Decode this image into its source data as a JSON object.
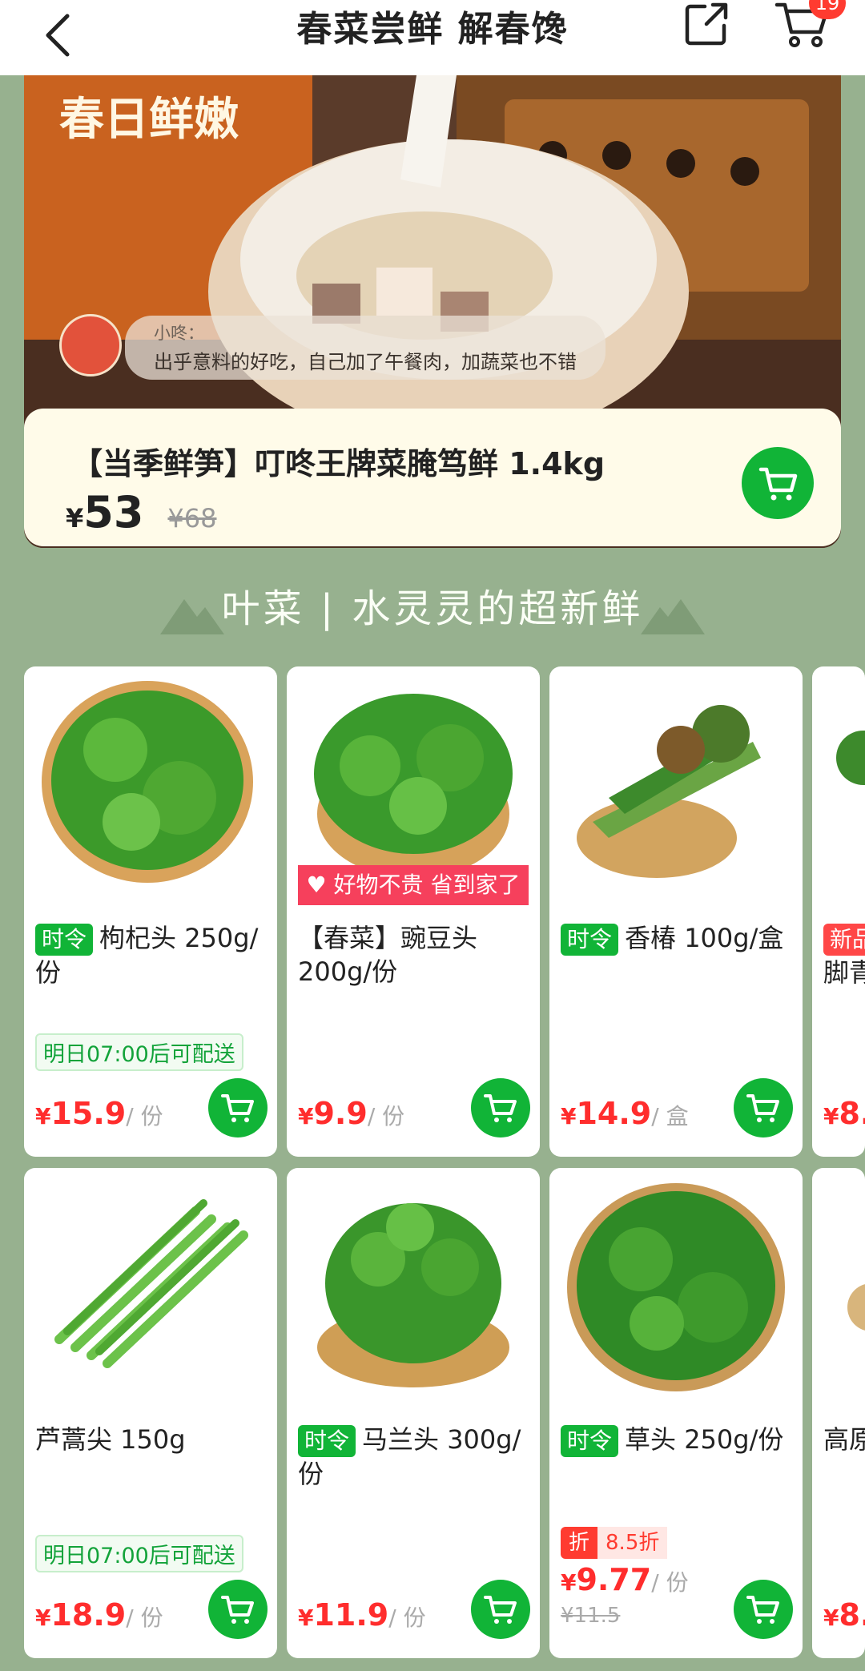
{
  "header": {
    "title": "春菜尝鲜 解春馋",
    "cart_badge": "19"
  },
  "hero": {
    "label": "春日鲜嫩",
    "comment_name": "小咚：",
    "comment_text": "出乎意料的好吃，自己加了午餐肉，加蔬菜也不错"
  },
  "promo": {
    "title": "【当季鲜笋】叮咚王牌菜腌笃鲜 1.4kg",
    "currency": "¥",
    "price": "53",
    "old_price": "¥68"
  },
  "section": {
    "title": "叶菜 | 水灵灵的超新鲜"
  },
  "products": [
    {
      "tag": "时令",
      "name": "枸杞头 250g/份",
      "delivery": "明日07:00后可配送",
      "currency": "¥",
      "price": "15.9",
      "unit": "/ 份"
    },
    {
      "ribbon": "好物不贵 省到家了",
      "name": "【春菜】豌豆头 200g/份",
      "currency": "¥",
      "price": "9.9",
      "unit": "/ 份"
    },
    {
      "tag": "时令",
      "name": "香椿 100g/盒",
      "currency": "¥",
      "price": "14.9",
      "unit": "/ 盒"
    },
    {
      "tag": "新品",
      "name": "脚青",
      "currency": "¥",
      "price": "8."
    },
    {
      "name": "芦蒿尖 150g",
      "delivery": "明日07:00后可配送",
      "currency": "¥",
      "price": "18.9",
      "unit": "/ 份"
    },
    {
      "tag": "时令",
      "name": "马兰头 300g/份",
      "currency": "¥",
      "price": "11.9",
      "unit": "/ 份"
    },
    {
      "tag": "时令",
      "name": "草头 250g/份",
      "discount_label": "折",
      "discount_value": "8.5折",
      "currency": "¥",
      "price": "9.77",
      "unit": "/ 份",
      "old_price": "¥11.5"
    },
    {
      "name": "高原",
      "currency": "¥",
      "price": "8."
    }
  ],
  "colors": {
    "brand_green": "#11b437",
    "price_red": "#ff2d2d",
    "page_bg": "#97b18f"
  }
}
